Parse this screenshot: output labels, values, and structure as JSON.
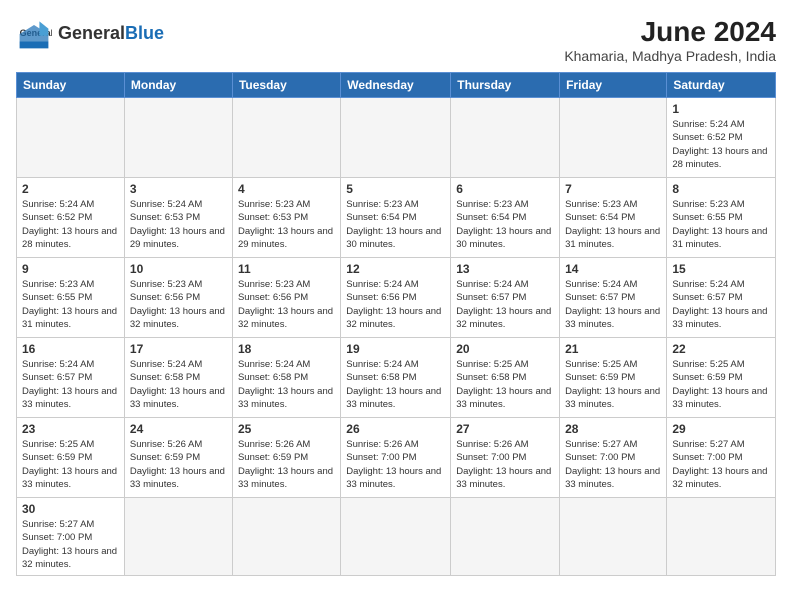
{
  "header": {
    "logo_general": "General",
    "logo_blue": "Blue",
    "month_year": "June 2024",
    "location": "Khamaria, Madhya Pradesh, India"
  },
  "days_of_week": [
    "Sunday",
    "Monday",
    "Tuesday",
    "Wednesday",
    "Thursday",
    "Friday",
    "Saturday"
  ],
  "weeks": [
    [
      {
        "day": "",
        "info": ""
      },
      {
        "day": "",
        "info": ""
      },
      {
        "day": "",
        "info": ""
      },
      {
        "day": "",
        "info": ""
      },
      {
        "day": "",
        "info": ""
      },
      {
        "day": "",
        "info": ""
      },
      {
        "day": "1",
        "info": "Sunrise: 5:24 AM\nSunset: 6:52 PM\nDaylight: 13 hours and 28 minutes."
      }
    ],
    [
      {
        "day": "2",
        "info": "Sunrise: 5:24 AM\nSunset: 6:52 PM\nDaylight: 13 hours and 28 minutes."
      },
      {
        "day": "3",
        "info": "Sunrise: 5:24 AM\nSunset: 6:53 PM\nDaylight: 13 hours and 29 minutes."
      },
      {
        "day": "4",
        "info": "Sunrise: 5:23 AM\nSunset: 6:53 PM\nDaylight: 13 hours and 29 minutes."
      },
      {
        "day": "5",
        "info": "Sunrise: 5:23 AM\nSunset: 6:54 PM\nDaylight: 13 hours and 30 minutes."
      },
      {
        "day": "6",
        "info": "Sunrise: 5:23 AM\nSunset: 6:54 PM\nDaylight: 13 hours and 30 minutes."
      },
      {
        "day": "7",
        "info": "Sunrise: 5:23 AM\nSunset: 6:54 PM\nDaylight: 13 hours and 31 minutes."
      },
      {
        "day": "8",
        "info": "Sunrise: 5:23 AM\nSunset: 6:55 PM\nDaylight: 13 hours and 31 minutes."
      }
    ],
    [
      {
        "day": "9",
        "info": "Sunrise: 5:23 AM\nSunset: 6:55 PM\nDaylight: 13 hours and 31 minutes."
      },
      {
        "day": "10",
        "info": "Sunrise: 5:23 AM\nSunset: 6:56 PM\nDaylight: 13 hours and 32 minutes."
      },
      {
        "day": "11",
        "info": "Sunrise: 5:23 AM\nSunset: 6:56 PM\nDaylight: 13 hours and 32 minutes."
      },
      {
        "day": "12",
        "info": "Sunrise: 5:24 AM\nSunset: 6:56 PM\nDaylight: 13 hours and 32 minutes."
      },
      {
        "day": "13",
        "info": "Sunrise: 5:24 AM\nSunset: 6:57 PM\nDaylight: 13 hours and 32 minutes."
      },
      {
        "day": "14",
        "info": "Sunrise: 5:24 AM\nSunset: 6:57 PM\nDaylight: 13 hours and 33 minutes."
      },
      {
        "day": "15",
        "info": "Sunrise: 5:24 AM\nSunset: 6:57 PM\nDaylight: 13 hours and 33 minutes."
      }
    ],
    [
      {
        "day": "16",
        "info": "Sunrise: 5:24 AM\nSunset: 6:57 PM\nDaylight: 13 hours and 33 minutes."
      },
      {
        "day": "17",
        "info": "Sunrise: 5:24 AM\nSunset: 6:58 PM\nDaylight: 13 hours and 33 minutes."
      },
      {
        "day": "18",
        "info": "Sunrise: 5:24 AM\nSunset: 6:58 PM\nDaylight: 13 hours and 33 minutes."
      },
      {
        "day": "19",
        "info": "Sunrise: 5:24 AM\nSunset: 6:58 PM\nDaylight: 13 hours and 33 minutes."
      },
      {
        "day": "20",
        "info": "Sunrise: 5:25 AM\nSunset: 6:58 PM\nDaylight: 13 hours and 33 minutes."
      },
      {
        "day": "21",
        "info": "Sunrise: 5:25 AM\nSunset: 6:59 PM\nDaylight: 13 hours and 33 minutes."
      },
      {
        "day": "22",
        "info": "Sunrise: 5:25 AM\nSunset: 6:59 PM\nDaylight: 13 hours and 33 minutes."
      }
    ],
    [
      {
        "day": "23",
        "info": "Sunrise: 5:25 AM\nSunset: 6:59 PM\nDaylight: 13 hours and 33 minutes."
      },
      {
        "day": "24",
        "info": "Sunrise: 5:26 AM\nSunset: 6:59 PM\nDaylight: 13 hours and 33 minutes."
      },
      {
        "day": "25",
        "info": "Sunrise: 5:26 AM\nSunset: 6:59 PM\nDaylight: 13 hours and 33 minutes."
      },
      {
        "day": "26",
        "info": "Sunrise: 5:26 AM\nSunset: 7:00 PM\nDaylight: 13 hours and 33 minutes."
      },
      {
        "day": "27",
        "info": "Sunrise: 5:26 AM\nSunset: 7:00 PM\nDaylight: 13 hours and 33 minutes."
      },
      {
        "day": "28",
        "info": "Sunrise: 5:27 AM\nSunset: 7:00 PM\nDaylight: 13 hours and 33 minutes."
      },
      {
        "day": "29",
        "info": "Sunrise: 5:27 AM\nSunset: 7:00 PM\nDaylight: 13 hours and 32 minutes."
      }
    ],
    [
      {
        "day": "30",
        "info": "Sunrise: 5:27 AM\nSunset: 7:00 PM\nDaylight: 13 hours and 32 minutes."
      },
      {
        "day": "",
        "info": ""
      },
      {
        "day": "",
        "info": ""
      },
      {
        "day": "",
        "info": ""
      },
      {
        "day": "",
        "info": ""
      },
      {
        "day": "",
        "info": ""
      },
      {
        "day": "",
        "info": ""
      }
    ]
  ]
}
